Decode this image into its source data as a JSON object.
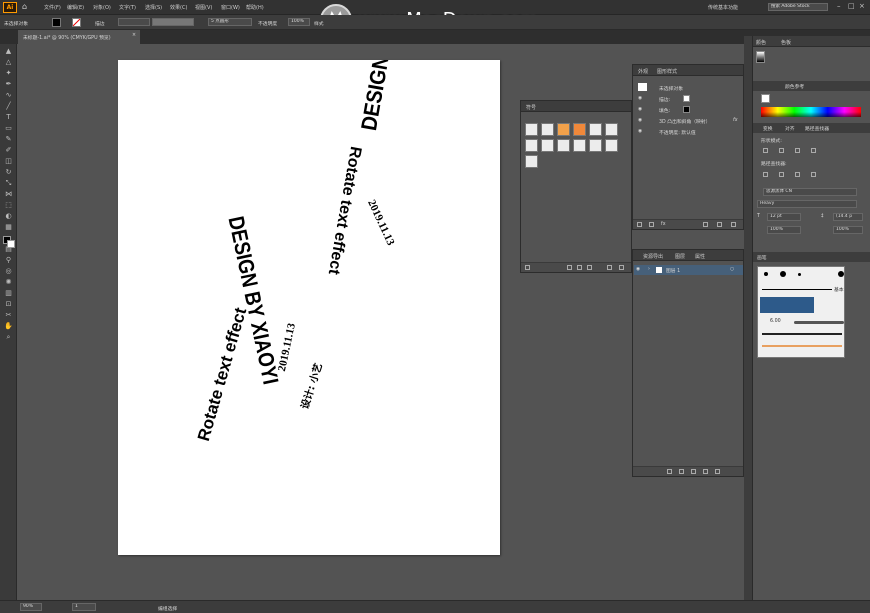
{
  "menubar": {
    "app_logo": "Ai",
    "items": [
      "文件(F)",
      "编辑(E)",
      "对象(O)",
      "文字(T)",
      "选择(S)",
      "效果(C)",
      "视图(V)",
      "窗口(W)",
      "帮助(H)"
    ],
    "workspace": "传统基本功能",
    "search_placeholder": "搜索 Adobe Stock"
  },
  "watermark": {
    "text": "www.MacDown.com"
  },
  "control": {
    "selection": "未选择对象",
    "stroke_label": "描边",
    "brush_value": "5 点圆形",
    "opacity_label": "不透明度",
    "opacity_value": "100%",
    "style_label": "样式"
  },
  "document": {
    "tab_title": "未标题-1.ai* @ 90% (CMYK/GPU 预览)"
  },
  "artwork": {
    "title_line": "DESIGN BY XIAOYI",
    "sub_line": "Rotate text effect",
    "date_line": "2019.11.13",
    "chinese_line": "设计: 小艺"
  },
  "status": {
    "zoom": "90%",
    "page": "1",
    "mode": "编组选择"
  },
  "symbols_panel": {
    "title": "符号"
  },
  "appearance_panel": {
    "tabs": [
      "外观",
      "图形样式"
    ],
    "target": "未选择对象",
    "rows": [
      "描边:",
      "填色:",
      "3D 凸出和斜角（映射）",
      "不透明度: 默认值"
    ],
    "fx": "fx"
  },
  "layers_panel": {
    "tabs": [
      "资源导出",
      "图层",
      "属性"
    ],
    "layer_name": "图层 1"
  },
  "right_dock": {
    "color_tabs": [
      "颜色",
      "色板"
    ],
    "color_label": "颜色参考",
    "swatch_tabs": [
      "色板",
      "画笔",
      "符号"
    ],
    "transform_tabs": [
      "变换",
      "对齐",
      "路径查找器"
    ],
    "shape_modes_label": "形状模式:",
    "pathfinder_label": "路径查找器:",
    "font_name": "思源黑体 CN",
    "font_style": "Heavy",
    "font_size": "12 pt",
    "leading": "(14.4 p",
    "tracking": "100%",
    "brush_panel_title": "画笔",
    "brush_basic_label": "基本",
    "brush_size_label": "6.00"
  }
}
